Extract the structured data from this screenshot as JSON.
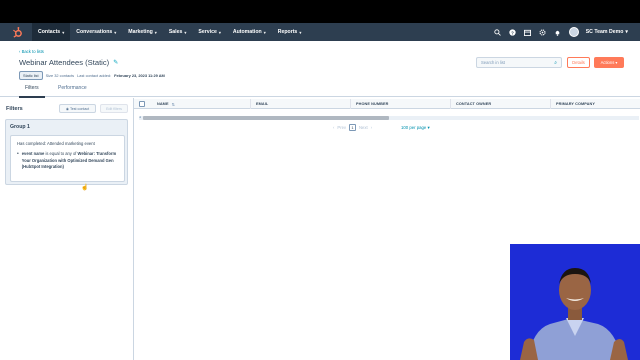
{
  "nav": {
    "logo_icon": "hubspot-sprocket-icon",
    "items": [
      {
        "label": "Contacts",
        "active": true
      },
      {
        "label": "Conversations",
        "active": false
      },
      {
        "label": "Marketing",
        "active": false
      },
      {
        "label": "Sales",
        "active": false
      },
      {
        "label": "Service",
        "active": false
      },
      {
        "label": "Automation",
        "active": false
      },
      {
        "label": "Reports",
        "active": false
      }
    ],
    "right_icons": [
      "search-icon",
      "help-icon",
      "marketplace-icon",
      "settings-icon",
      "notifications-icon"
    ],
    "account_label": "SC Team Demo"
  },
  "header": {
    "back_link": "Back to lists",
    "title": "Webinar Attendees (Static)",
    "badge": "Static list",
    "size_text": "Size 32 contacts",
    "last_added_label": "Last contact added:",
    "last_added_value": "February 23, 2023 11:29 AM",
    "search_placeholder": "Search in list",
    "details_label": "Details",
    "actions_label": "Actions"
  },
  "tabs": [
    {
      "label": "Filters",
      "active": true
    },
    {
      "label": "Performance",
      "active": false
    }
  ],
  "filters": {
    "title": "Filters",
    "test_contact_label": "Test contact",
    "edit_filters_label": "Edit filters",
    "group_title": "Group 1",
    "condition": "Has completed: Attended marketing event",
    "sub_bold": "event name",
    "sub_text": "is equal to any of",
    "sub_value": "Webinar: Transform Your Organization with Optimized Demand Gen (HubSpot Integration)"
  },
  "table": {
    "columns": [
      "NAME",
      "EMAIL",
      "PHONE NUMBER",
      "CONTACT OWNER",
      "PRIMARY COMPANY"
    ]
  },
  "pagination": {
    "prev_label": "Prev",
    "page": "1",
    "next_label": "Next",
    "per_page": "100 per page"
  },
  "colors": {
    "nav_bg": "#2d3e50",
    "accent_orange": "#ff7a59",
    "link_teal": "#0091ae",
    "video_bg": "#1d2cd6"
  }
}
